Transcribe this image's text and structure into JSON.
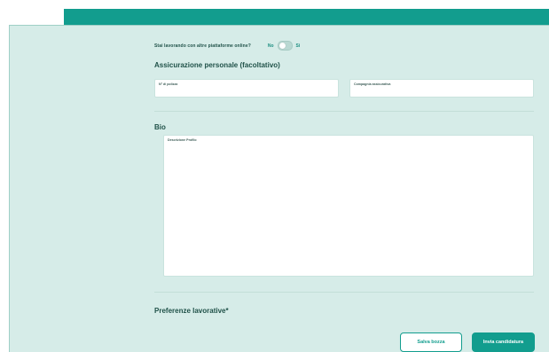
{
  "form": {
    "online_question": "Stai lavorando con altre piattaforme online?",
    "toggle": {
      "no_label": "No",
      "yes_label": "Si",
      "value": "No"
    },
    "insurance": {
      "title": "Assicurazione personale (facoltativo)",
      "policy_label": "N° di polizza",
      "company_label": "Compagnia assicurativa"
    },
    "bio": {
      "title": "Bio",
      "description_label": "Descrizione Profilo"
    },
    "preferences": {
      "title": "Preferenze lavorative*"
    }
  },
  "actions": {
    "draft_label": "Salva bozza",
    "submit_label": "Invia candidatura"
  },
  "colors": {
    "brand_teal": "#129d8e",
    "panel_background": "#d6ece8",
    "heading_text": "#1f5148"
  }
}
